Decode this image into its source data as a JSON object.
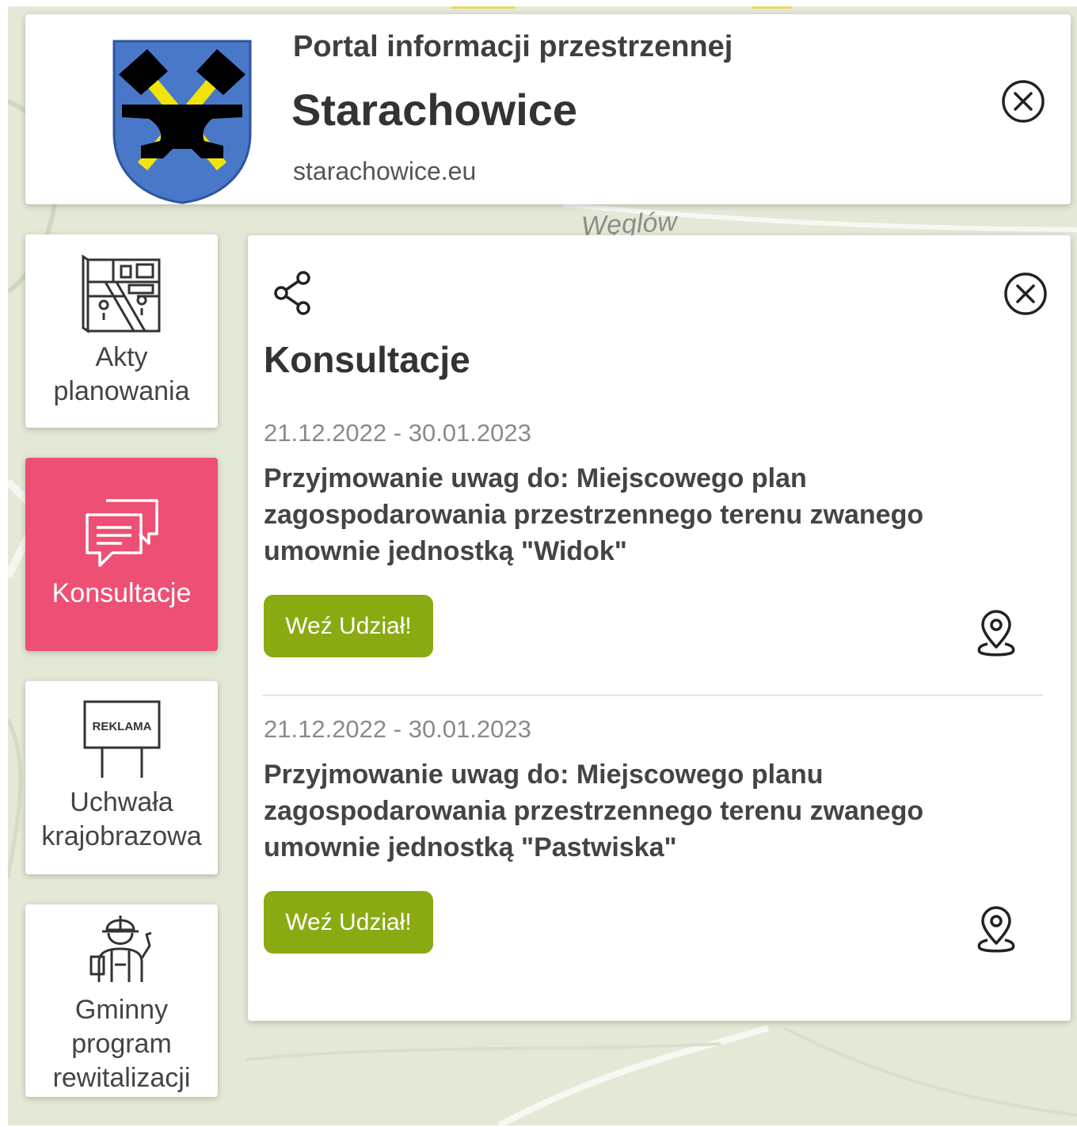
{
  "header": {
    "portal_title": "Portal informacji przestrzennej",
    "city_name": "Starachowice",
    "city_url": "starachowice.eu"
  },
  "map": {
    "label": "Węglów"
  },
  "sidebar": {
    "items": [
      {
        "label": "Akty planowania",
        "icon": "city-plan-map-icon",
        "active": false
      },
      {
        "label": "Konsultacje",
        "icon": "chat-bubbles-icon",
        "active": true
      },
      {
        "label": "Uchwała krajobrazowa",
        "icon": "billboard-icon",
        "icon_text": "REKLAMA",
        "active": false
      },
      {
        "label": "Gminny program rewitalizacji",
        "icon": "construction-worker-icon",
        "active": false
      }
    ]
  },
  "panel": {
    "title": "Konsultacje",
    "consultations": [
      {
        "dates": "21.12.2022 - 30.01.2023",
        "title": "Przyjmowanie uwag do: Miejscowego plan zagospodarowania przestrzennego terenu zwanego umownie jednostką \"Widok\"",
        "button_label": "Weź Udział!"
      },
      {
        "dates": "21.12.2022 - 30.01.2023",
        "title": "Przyjmowanie uwag do: Miejscowego planu zagospodarowania przestrzennego terenu zwanego umownie jednostką \"Pastwiska\"",
        "button_label": "Weź Udział!"
      }
    ]
  },
  "colors": {
    "active_sidebar": "#ee4f74",
    "button": "#8aaa12",
    "map_background": "#e3e9d6",
    "logo_shield": "#4a78c8",
    "logo_yellow": "#f2e40a"
  }
}
